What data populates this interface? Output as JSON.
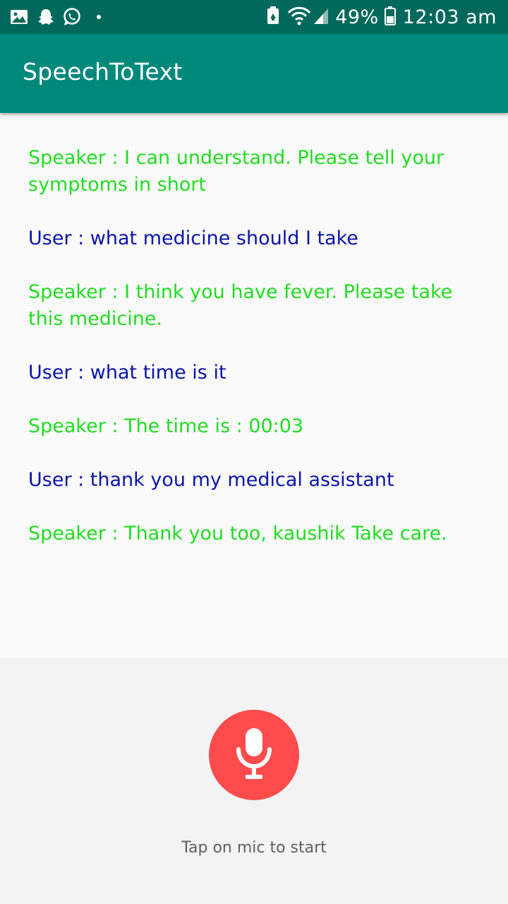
{
  "status_bar": {
    "battery_percent": "49%",
    "time": "12:03 am",
    "icons": [
      "gallery-icon",
      "snapchat-icon",
      "whatsapp-icon",
      "dot-icon",
      "battery-saver-icon",
      "wifi-icon",
      "signal-icon",
      "battery-icon"
    ]
  },
  "app_bar": {
    "title": "SpeechToText"
  },
  "conversation": [
    {
      "role": "speaker",
      "text": "Speaker : I can understand. Please tell your symptoms in short"
    },
    {
      "role": "user",
      "text": "User : what medicine should I take"
    },
    {
      "role": "speaker",
      "text": "Speaker : I think you have fever. Please take this medicine."
    },
    {
      "role": "user",
      "text": "User : what time is it"
    },
    {
      "role": "speaker",
      "text": "Speaker : The time is : 00:03"
    },
    {
      "role": "user",
      "text": "User : thank you my medical assistant"
    },
    {
      "role": "speaker",
      "text": "Speaker : Thank you too, kaushik Take care."
    }
  ],
  "mic": {
    "icon": "microphone-icon",
    "hint": "Tap on mic to start"
  },
  "colors": {
    "status_bar": "#00695c",
    "app_bar": "#00897b",
    "speaker_text": "#22dd22",
    "user_text": "#0a14a8",
    "mic_button": "#ff4b4b"
  }
}
